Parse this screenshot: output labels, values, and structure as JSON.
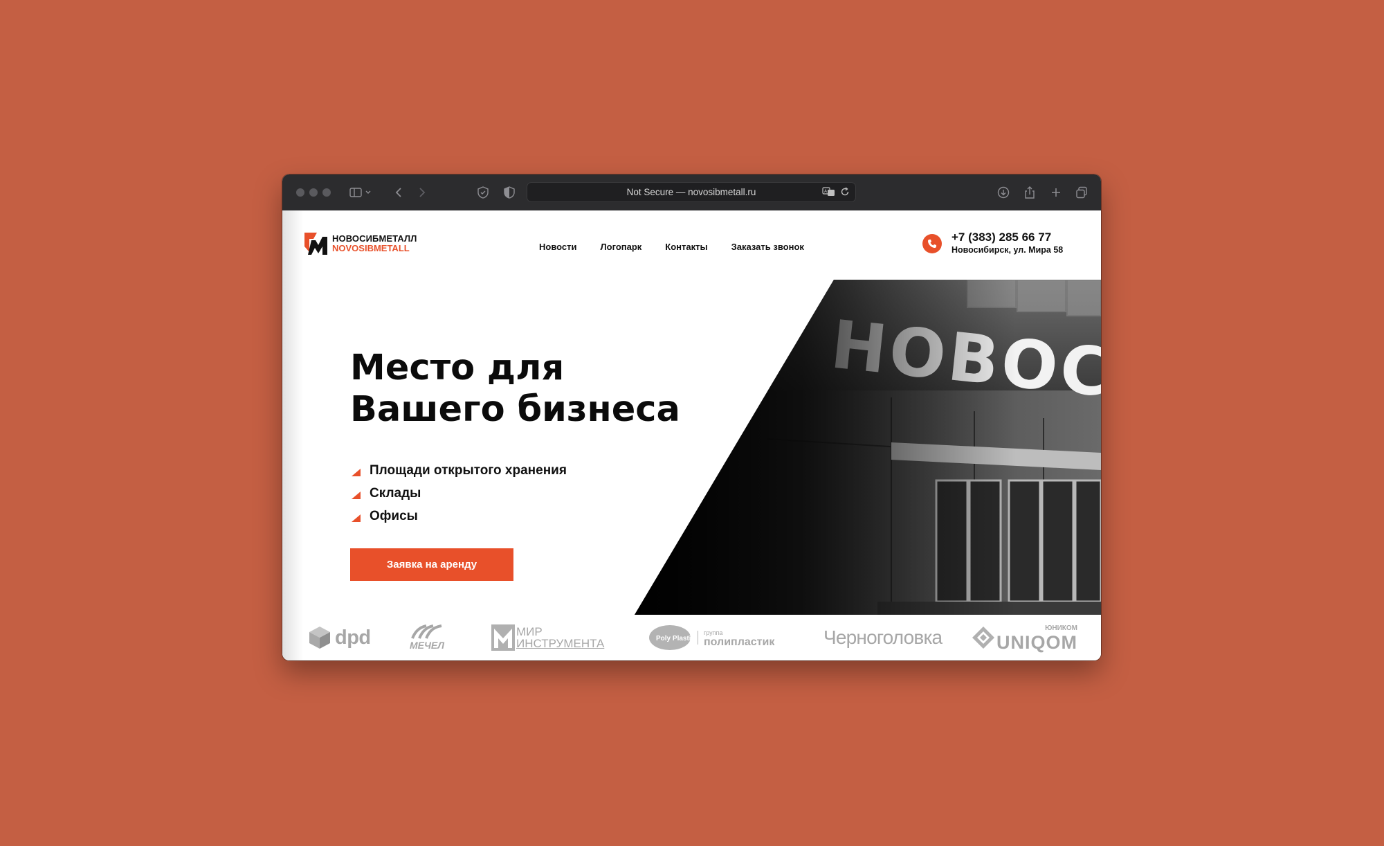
{
  "browser": {
    "url_text": "Not Secure — novosibmetall.ru"
  },
  "site": {
    "logo": {
      "ru": "НОВОСИБМЕТАЛЛ",
      "en": "NOVOSIBMETALL"
    },
    "nav": [
      {
        "label": "Новости"
      },
      {
        "label": "Логопарк"
      },
      {
        "label": "Контакты"
      },
      {
        "label": "Заказать звонок"
      }
    ],
    "contact": {
      "phone": "+7 (383) 285 66 77",
      "address": "Новосибирск, ул. Мира 58"
    },
    "hero": {
      "title_line1": "Место для",
      "title_line2": "Вашего бизнеса",
      "features": [
        "Площади открытого хранения",
        "Склады",
        "Офисы"
      ],
      "cta": "Заявка на аренду",
      "building_sign": "НОВОСИБ"
    },
    "partners": [
      {
        "name": "dpd"
      },
      {
        "name": "МЕЧЕЛ"
      },
      {
        "name_line1": "МИР",
        "name_line2": "ИНСТРУМЕНТА"
      },
      {
        "small": "группа",
        "name": "полипластик",
        "badge": "Poly Plastic"
      },
      {
        "name": "Черноголовка"
      },
      {
        "small": "ЮНИКОМ",
        "name": "UNIQOM"
      }
    ],
    "colors": {
      "accent": "#E8502A",
      "background": "#C45F43",
      "partner_gray": "#a7a7a7"
    }
  }
}
